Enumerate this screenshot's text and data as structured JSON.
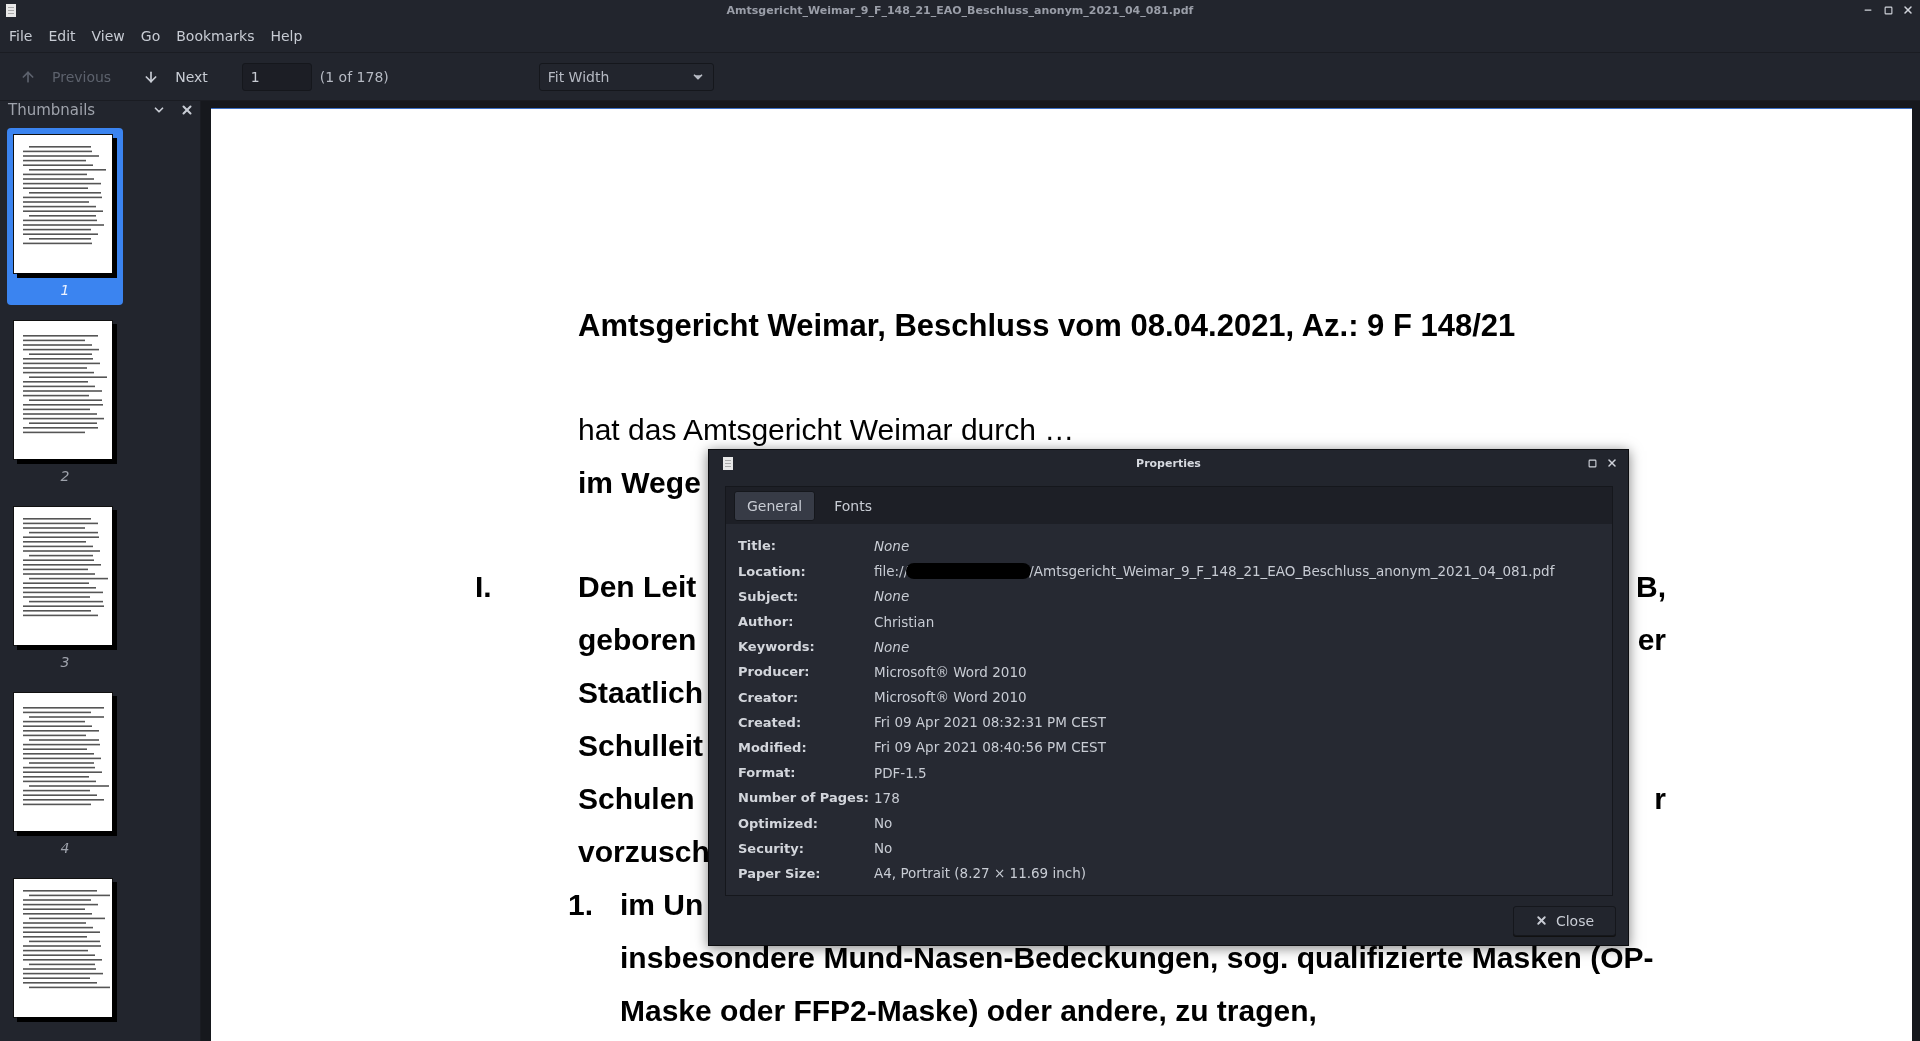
{
  "window": {
    "title": "Amtsgericht_Weimar_9_F_148_21_EAO_Beschluss_anonym_2021_04_081.pdf"
  },
  "menu": [
    "File",
    "Edit",
    "View",
    "Go",
    "Bookmarks",
    "Help"
  ],
  "toolbar": {
    "previous": {
      "label": "Previous",
      "disabled": true
    },
    "next": {
      "label": "Next",
      "disabled": false
    },
    "page_field": {
      "value": "1"
    },
    "page_count": "(1 of 178)",
    "zoom": {
      "value": "Fit Width"
    }
  },
  "sidebar": {
    "title": "Thumbnails",
    "thumbnails": [
      {
        "label": "1",
        "selected": true
      },
      {
        "label": "2",
        "selected": false
      },
      {
        "label": "3",
        "selected": false
      },
      {
        "label": "4",
        "selected": false
      },
      {
        "selected": false
      }
    ]
  },
  "document": {
    "blocks": [
      {
        "kind": "heading",
        "lines": [
          {
            "left": "Amtsgericht Weimar, Beschluss vom 08.04.2021, Az.: 9 F 148/21"
          }
        ]
      },
      {
        "kind": "regular",
        "lines": [
          {
            "left": "hat das Amtsgericht Weimar durch …"
          }
        ]
      },
      {
        "kind": "bold",
        "lines": [
          {
            "left": "im Wege"
          }
        ]
      },
      {
        "kind": "numbered",
        "marker": "I.",
        "lines": [
          {
            "left": "Den Leit",
            "right": "B,"
          },
          {
            "left": "geboren",
            "right": "er"
          },
          {
            "left": "Staatlich"
          },
          {
            "left": "Schulleit"
          },
          {
            "left": "Schulen",
            "right": "r"
          },
          {
            "left": "vorzusch"
          }
        ]
      },
      {
        "kind": "numbered",
        "marker": "1.",
        "lines": [
          {
            "left": "im Un"
          },
          {
            "left": "insbesondere Mund-Nasen-Bedeckungen, sog. qualifizierte Masken (OP-"
          },
          {
            "left": "Maske oder FFP2-Maske) oder andere, zu tragen,"
          }
        ]
      }
    ]
  },
  "dialog": {
    "title": "Properties",
    "tabs": [
      {
        "label": "General",
        "selected": true
      },
      {
        "label": "Fonts",
        "selected": false
      }
    ],
    "properties": [
      {
        "label": "Title:",
        "value": "None",
        "kind": "unset"
      },
      {
        "label": "Location:",
        "kind": "path",
        "prefix": "file://",
        "redacted": true,
        "value": "/Amtsgericht_Weimar_9_F_148_21_EAO_Beschluss_anonym_2021_04_081.pdf"
      },
      {
        "label": "Subject:",
        "value": "None",
        "kind": "unset"
      },
      {
        "label": "Author:",
        "value": "Christian",
        "kind": "text"
      },
      {
        "label": "Keywords:",
        "value": "None",
        "kind": "unset"
      },
      {
        "label": "Producer:",
        "value": "Microsoft® Word 2010",
        "kind": "text"
      },
      {
        "label": "Creator:",
        "value": "Microsoft® Word 2010",
        "kind": "text"
      },
      {
        "label": "Created:",
        "value": "Fri 09 Apr 2021 08:32:31 PM CEST",
        "kind": "text"
      },
      {
        "label": "Modified:",
        "value": "Fri 09 Apr 2021 08:40:56 PM CEST",
        "kind": "text"
      },
      {
        "label": "Format:",
        "value": "PDF-1.5",
        "kind": "text"
      },
      {
        "label": "Number of Pages:",
        "value": "178",
        "kind": "text"
      },
      {
        "label": "Optimized:",
        "value": "No",
        "kind": "text"
      },
      {
        "label": "Security:",
        "value": "No",
        "kind": "text"
      },
      {
        "label": "Paper Size:",
        "value": "A4, Portrait (8.27 × 11.69 inch)",
        "kind": "text"
      }
    ],
    "close_button": "Close"
  }
}
